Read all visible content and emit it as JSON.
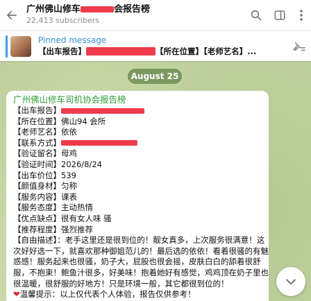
{
  "header": {
    "title_prefix": "广州佛山修车",
    "title_suffix": "会报告榜",
    "subscribers": "22,413 subscribers"
  },
  "pinned": {
    "label": "Pinned message",
    "text_prefix": "【出车报告】",
    "text_suffix": "【所在位置】【老师艺名】..."
  },
  "date_pill": "August 25",
  "message": {
    "header": "广州佛山修车司机协会报告榜",
    "lines": [
      "【出车报告】",
      "【所在位置】佛山94 会所",
      "【老师艺名】依依",
      "【联系方式】",
      "【验证留名】母鸡",
      "【验证时间】2026/8/24",
      "【出车价位】539",
      "【颜值身材】匀称",
      "【服务内容】课表",
      "【服务态度】主动热情",
      "【优点缺点】很有女人味 骚",
      "【推荐程度】强烈推荐"
    ],
    "description_lines": [
      "【自由描述】：老手这里还是很到位的！靓女真多，上次服务很满意！这",
      "次好好选一下，就喜欢那种御姐范儿的！最后选的依依！看着很骚的有魅",
      "惑感！服务起来也很骚，奶子大，屁股也很会摇，皮肤白白的舔着很舒",
      "服，不抱束！鲍鱼汁很多，好美味！抱着她好有感觉，鸡鸡顶在奶子里也",
      "很温暖，很舒服的好地方！只是环境一般，其它都很到位的！"
    ],
    "warning": "温馨提示：以上仅代表个人体验，报告仅供参考！"
  },
  "icons": {
    "back": "arrow-left-icon",
    "search": "search-icon",
    "sidebar": "sidebar-panel-icon",
    "more": "more-vertical-icon",
    "pin_list": "pin-list-icon",
    "scroll_down": "chevron-down-icon",
    "heart": "heart-icon"
  },
  "colors": {
    "accent_blue": "#3a8fd6",
    "sender_green": "#2d9d3a",
    "redaction": "#ef3b4a",
    "heart_red": "#e0243a"
  }
}
